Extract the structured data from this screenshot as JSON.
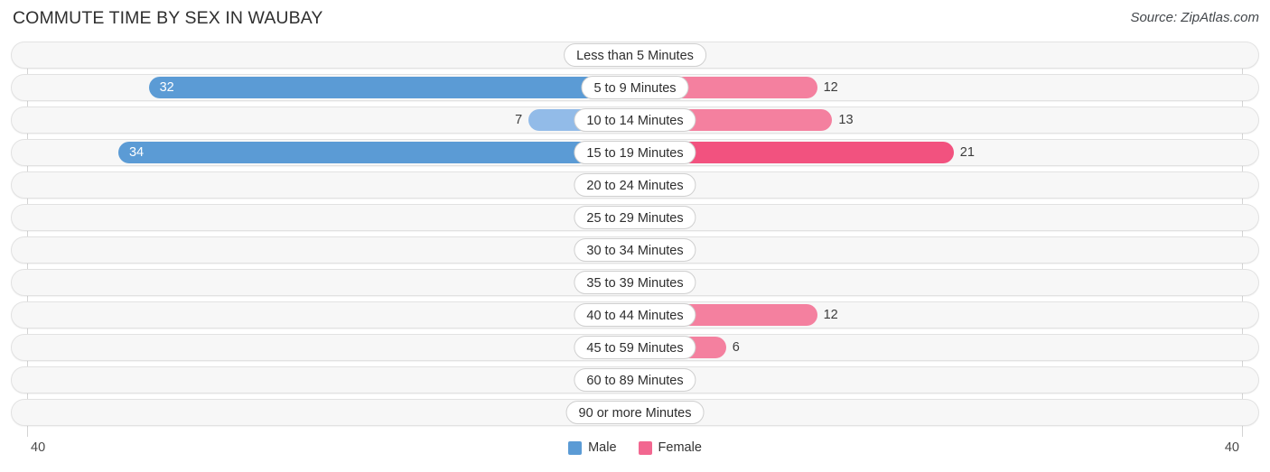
{
  "header": {
    "title": "COMMUTE TIME BY SEX IN WAUBAY",
    "source": "Source: ZipAtlas.com"
  },
  "axis": {
    "left_label": "40",
    "right_label": "40",
    "max": 40
  },
  "legend": {
    "items": [
      {
        "label": "Male",
        "color": "#5b9bd5"
      },
      {
        "label": "Female",
        "color": "#f26790"
      }
    ]
  },
  "colors": {
    "male_strong": "#5b9bd5",
    "male_mid": "#92bbe8",
    "male_pale": "#aac8ee",
    "female_strong": "#f2527f",
    "female_mid": "#f4809f",
    "female_pale": "#f9aec6",
    "track": "#f7f7f7",
    "track_border": "#e2e2e2",
    "gridline": "#d4d4d4"
  },
  "chart_data": {
    "type": "bar",
    "orientation": "horizontal-diverging",
    "title": "COMMUTE TIME BY SEX IN WAUBAY",
    "xlabel": "",
    "ylabel": "",
    "xlim": [
      40,
      40
    ],
    "grid": true,
    "legend_position": "bottom-center",
    "categories": [
      "Less than 5 Minutes",
      "5 to 9 Minutes",
      "10 to 14 Minutes",
      "15 to 19 Minutes",
      "20 to 24 Minutes",
      "25 to 29 Minutes",
      "30 to 34 Minutes",
      "35 to 39 Minutes",
      "40 to 44 Minutes",
      "45 to 59 Minutes",
      "60 to 89 Minutes",
      "90 or more Minutes"
    ],
    "series": [
      {
        "name": "Male",
        "values": [
          0,
          32,
          7,
          34,
          0,
          0,
          0,
          0,
          0,
          0,
          0,
          0
        ]
      },
      {
        "name": "Female",
        "values": [
          0,
          12,
          13,
          21,
          0,
          0,
          0,
          0,
          12,
          6,
          0,
          0
        ]
      }
    ]
  }
}
